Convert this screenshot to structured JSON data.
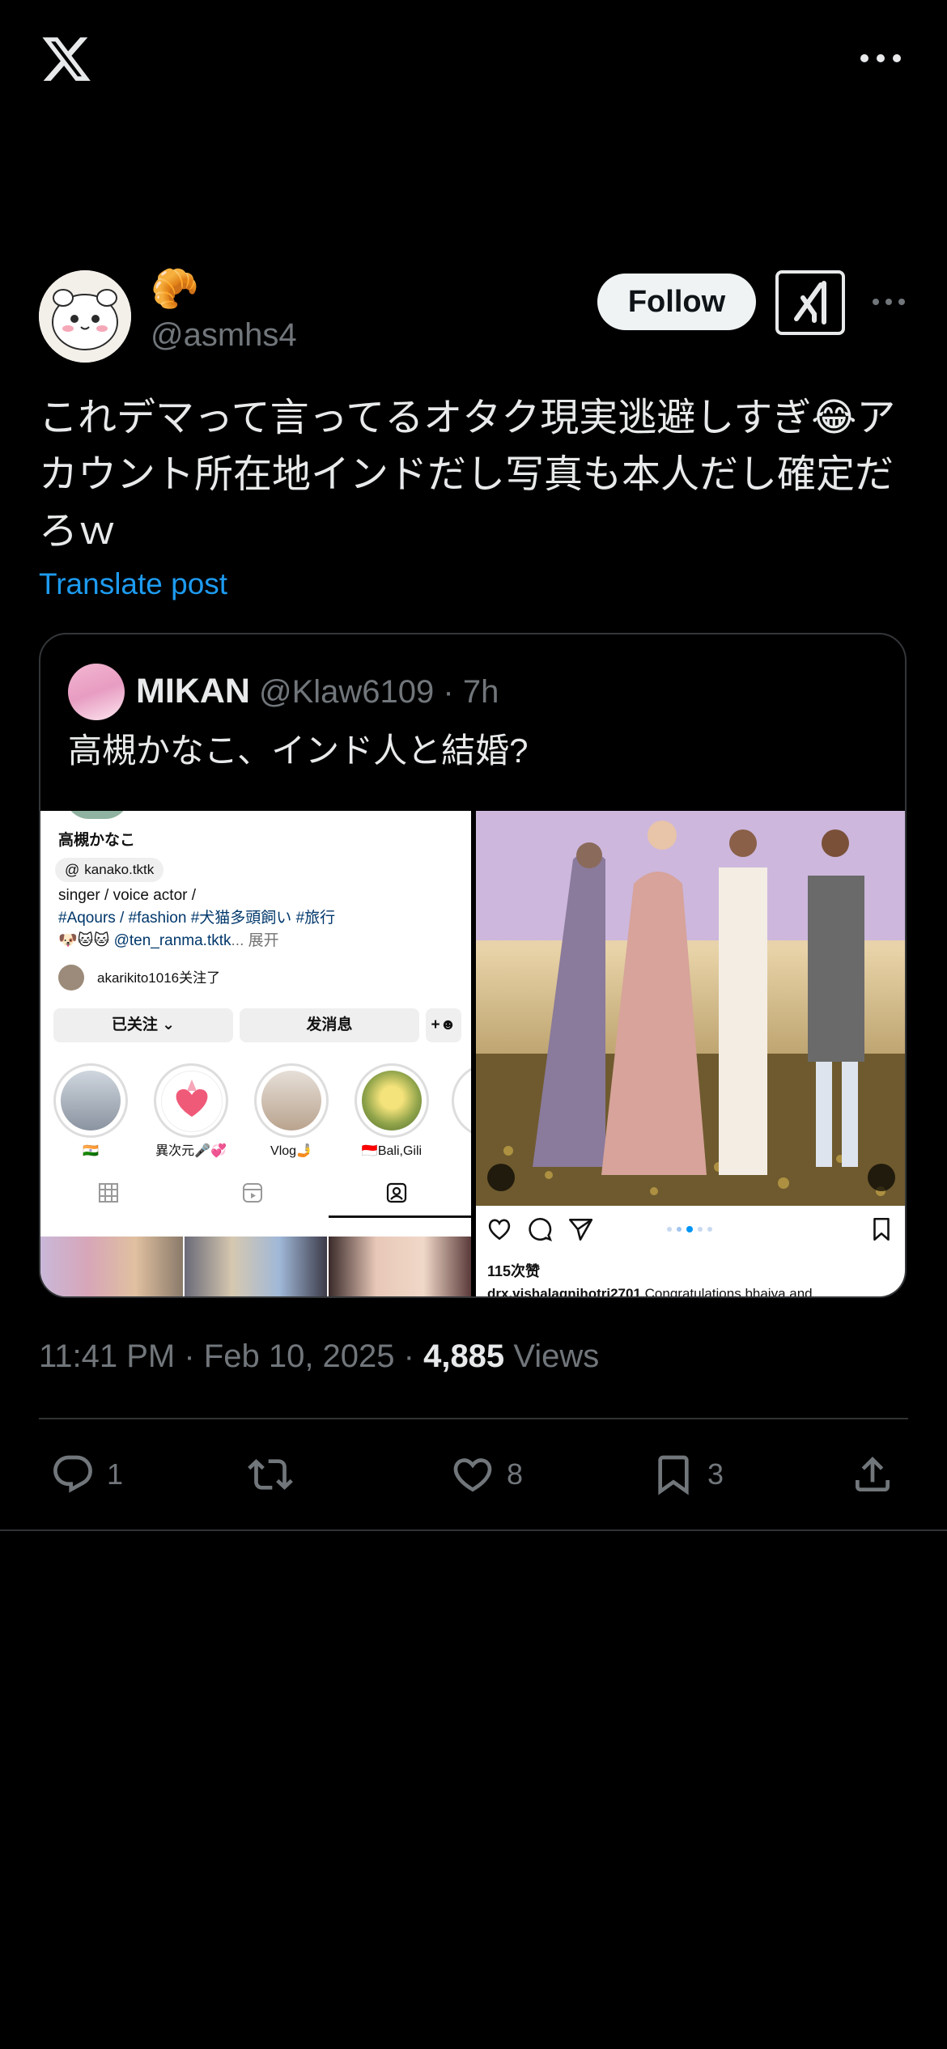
{
  "header": {
    "display_name_emoji": "🥐",
    "handle": "@asmhs4",
    "follow_label": "Follow"
  },
  "post": {
    "text": "これデマって言ってるオタク現実逃避しすぎ😂アカウント所在地インドだし写真も本人だし確定だろｗ",
    "translate_label": "Translate post"
  },
  "quote": {
    "name": "MIKAN",
    "handle_time": "@Klaw6109 · 7h",
    "text": "高槻かなこ、インド人と結婚?",
    "left_image": {
      "profile_name": "高槻かなこ",
      "threads_tag": "kanako.tktk",
      "bio1": "singer / voice actor /",
      "bio2": "#Aqours / #fashion #犬猫多頭飼い #旅行",
      "bio3_prefix": "🐶🐱🐱",
      "bio3_link": "@ten_ranma.tktk",
      "bio3_more": "... 展开",
      "followed_by": "akarikito1016关注了",
      "btn_following": "已关注 ⌄",
      "btn_message": "发消息",
      "highlights": [
        {
          "label": "🇮🇳"
        },
        {
          "label": "異次元🎤💞"
        },
        {
          "label": "Vlog🤳"
        },
        {
          "label": "🇮🇩Bali,Gili"
        }
      ]
    },
    "right_image": {
      "likes": "115次赞",
      "caption_user": "drx.vishalagnihotri2701",
      "caption_text": "Congratulations bhaiya and"
    }
  },
  "meta": {
    "time": "11:41 PM · Feb 10, 2025 · ",
    "views_count": "4,885",
    "views_label": "Views"
  },
  "actions": {
    "replies": "1",
    "likes": "8",
    "bookmarks": "3"
  }
}
